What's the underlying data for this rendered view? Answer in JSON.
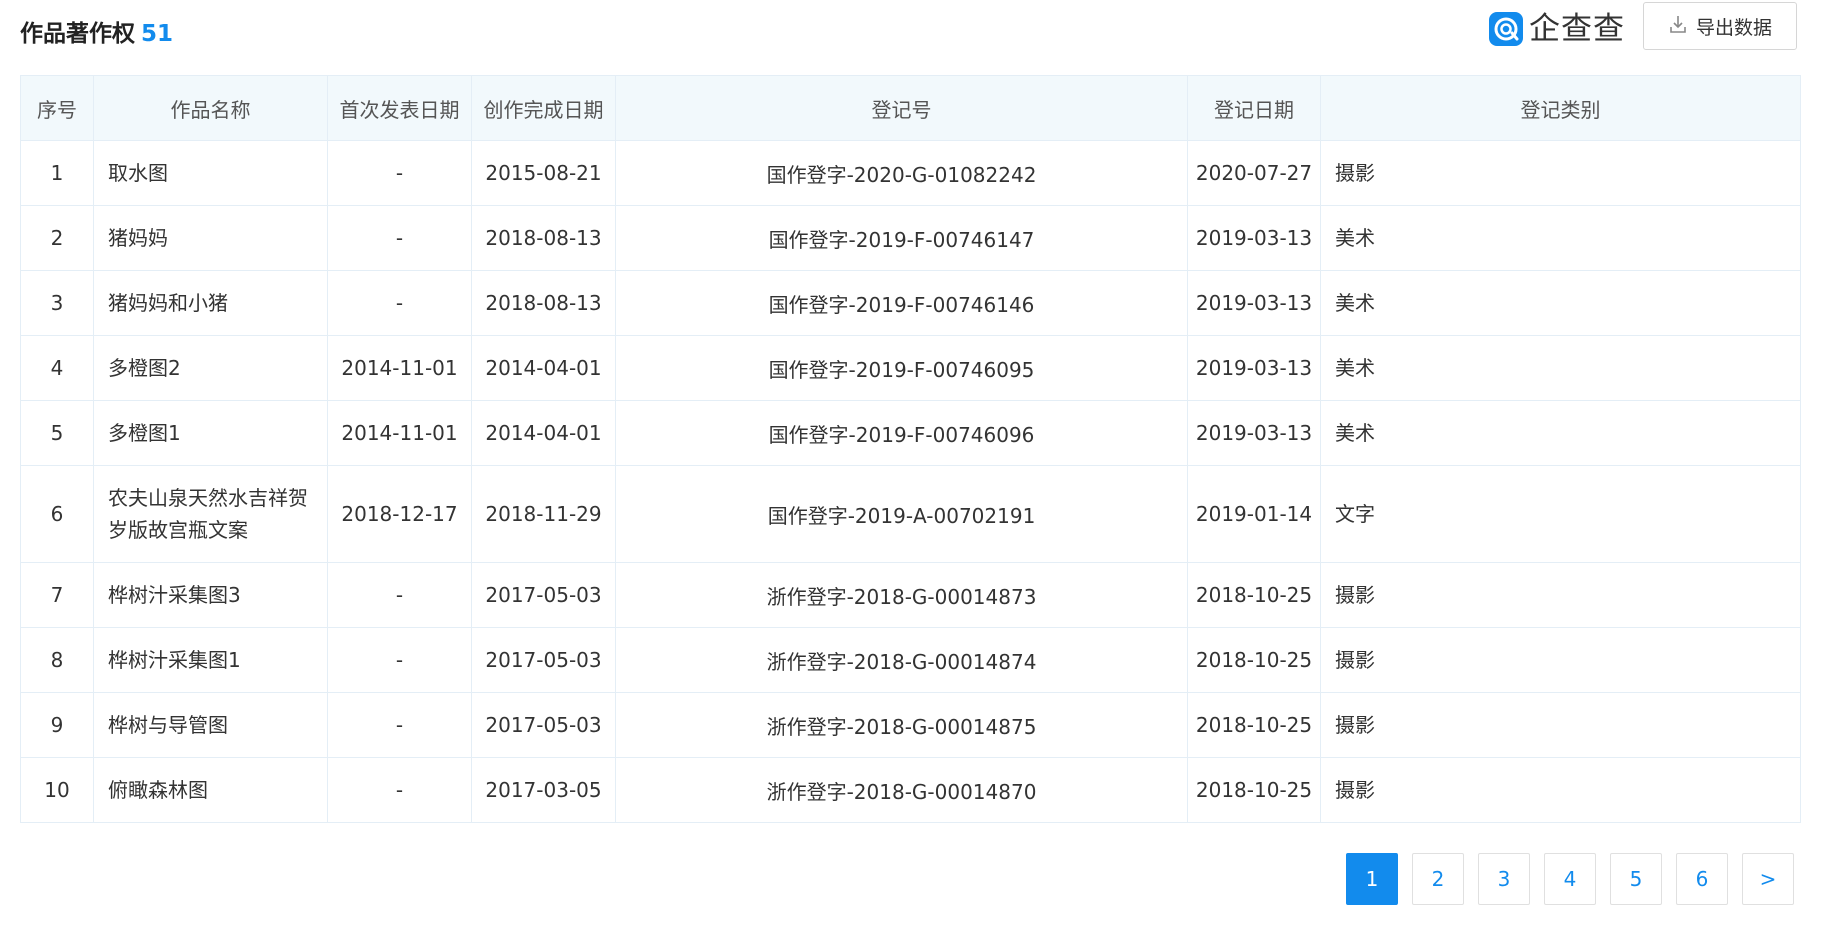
{
  "header": {
    "title": "作品著作权",
    "count": "51",
    "brand_name": "企查查",
    "export_label": "导出数据"
  },
  "table": {
    "columns": [
      "序号",
      "作品名称",
      "首次发表日期",
      "创作完成日期",
      "登记号",
      "登记日期",
      "登记类别"
    ],
    "rows": [
      [
        "1",
        "取水图",
        "-",
        "2015-08-21",
        "国作登字-2020-G-01082242",
        "2020-07-27",
        "摄影"
      ],
      [
        "2",
        "猪妈妈",
        "-",
        "2018-08-13",
        "国作登字-2019-F-00746147",
        "2019-03-13",
        "美术"
      ],
      [
        "3",
        "猪妈妈和小猪",
        "-",
        "2018-08-13",
        "国作登字-2019-F-00746146",
        "2019-03-13",
        "美术"
      ],
      [
        "4",
        "多橙图2",
        "2014-11-01",
        "2014-04-01",
        "国作登字-2019-F-00746095",
        "2019-03-13",
        "美术"
      ],
      [
        "5",
        "多橙图1",
        "2014-11-01",
        "2014-04-01",
        "国作登字-2019-F-00746096",
        "2019-03-13",
        "美术"
      ],
      [
        "6",
        "农夫山泉天然水吉祥贺岁版故宫瓶文案",
        "2018-12-17",
        "2018-11-29",
        "国作登字-2019-A-00702191",
        "2019-01-14",
        "文字"
      ],
      [
        "7",
        "桦树汁采集图3",
        "-",
        "2017-05-03",
        "浙作登字-2018-G-00014873",
        "2018-10-25",
        "摄影"
      ],
      [
        "8",
        "桦树汁采集图1",
        "-",
        "2017-05-03",
        "浙作登字-2018-G-00014874",
        "2018-10-25",
        "摄影"
      ],
      [
        "9",
        "桦树与导管图",
        "-",
        "2017-05-03",
        "浙作登字-2018-G-00014875",
        "2018-10-25",
        "摄影"
      ],
      [
        "10",
        "俯瞰森林图",
        "-",
        "2017-03-05",
        "浙作登字-2018-G-00014870",
        "2018-10-25",
        "摄影"
      ]
    ]
  },
  "pagination": {
    "pages": [
      "1",
      "2",
      "3",
      "4",
      "5",
      "6"
    ],
    "current": "1",
    "next_label": ">"
  },
  "colors": {
    "accent": "#128bed",
    "header_bg": "#f2f9fc",
    "border": "#e4eef6"
  },
  "icons": {
    "brand": "qichacha-logo-icon",
    "export": "download-icon"
  }
}
